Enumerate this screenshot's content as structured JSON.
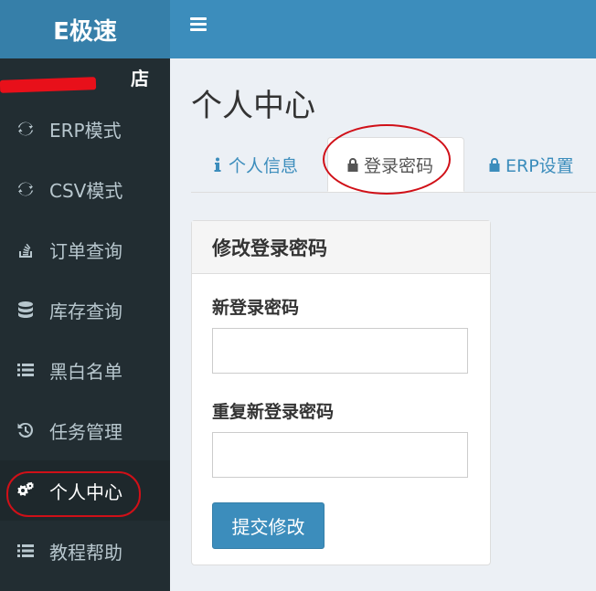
{
  "app": {
    "logo": "E极速"
  },
  "sidebar": {
    "store_name": "店",
    "items": [
      {
        "label": "ERP模式",
        "icon": "refresh-icon"
      },
      {
        "label": "CSV模式",
        "icon": "refresh-icon"
      },
      {
        "label": "订单查询",
        "icon": "stack-overflow-icon"
      },
      {
        "label": "库存查询",
        "icon": "database-icon"
      },
      {
        "label": "黑白名单",
        "icon": "list-icon"
      },
      {
        "label": "任务管理",
        "icon": "history-icon"
      },
      {
        "label": "个人中心",
        "icon": "cogs-icon",
        "active": true
      },
      {
        "label": "教程帮助",
        "icon": "list-icon"
      }
    ]
  },
  "main": {
    "title": "个人中心",
    "tabs": [
      {
        "label": "个人信息",
        "icon": "info-icon"
      },
      {
        "label": "登录密码",
        "icon": "lock-icon",
        "active": true
      },
      {
        "label": "ERP设置",
        "icon": "lock-icon"
      }
    ],
    "panel": {
      "heading": "修改登录密码",
      "fields": [
        {
          "label": "新登录密码",
          "value": "",
          "placeholder": ""
        },
        {
          "label": "重复新登录密码",
          "value": "",
          "placeholder": ""
        }
      ],
      "submit_label": "提交修改"
    }
  },
  "colors": {
    "topbar": "#3c8dbc",
    "logo_bar": "#367fa9",
    "sidebar": "#222d32",
    "annotation": "#d01018"
  }
}
